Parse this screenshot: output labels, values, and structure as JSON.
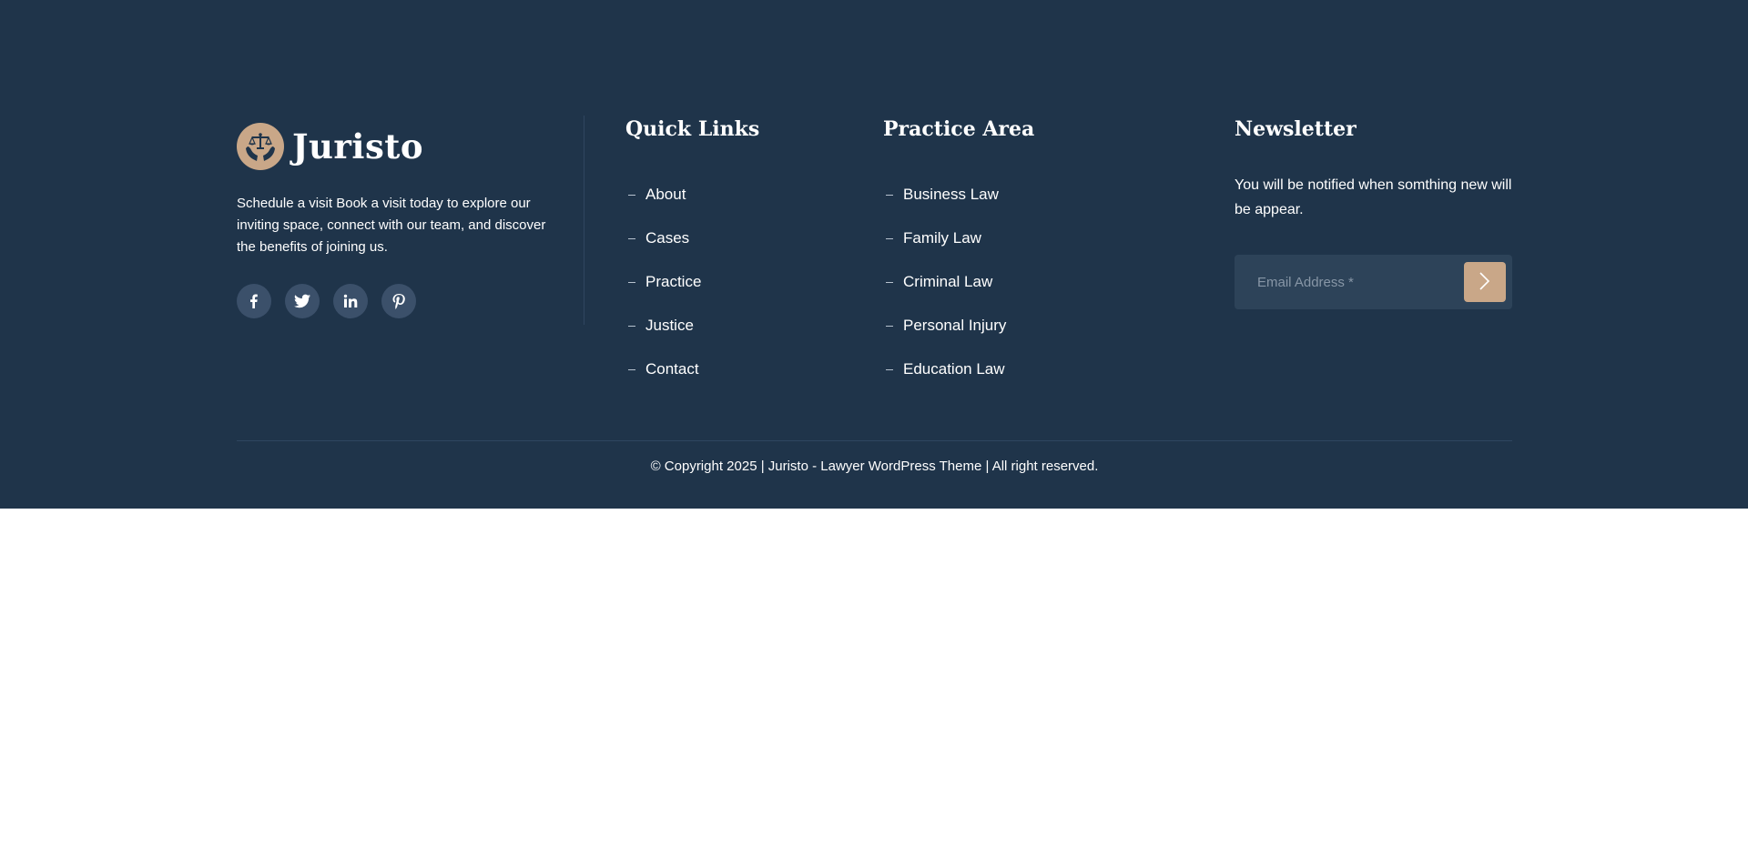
{
  "brand": {
    "name": "Juristo",
    "description": "Schedule a visit Book a visit today to explore our inviting space, connect with our team, and discover the benefits of joining us.",
    "logo_icon": "scales-of-justice-in-hands-icon",
    "accent_color": "#c9a788",
    "socials": [
      {
        "icon": "facebook-icon"
      },
      {
        "icon": "twitter-icon"
      },
      {
        "icon": "linkedin-icon"
      },
      {
        "icon": "pinterest-icon"
      }
    ]
  },
  "quick_links": {
    "title": "Quick Links",
    "items": [
      "About",
      "Cases",
      "Practice",
      "Justice",
      "Contact"
    ]
  },
  "practice_area": {
    "title": "Practice Area",
    "items": [
      "Business Law",
      "Family Law",
      "Criminal Law",
      "Personal Injury",
      "Education Law"
    ]
  },
  "newsletter": {
    "title": "Newsletter",
    "description": "You will be notified when somthing new will be appear.",
    "email_placeholder": "Email Address *",
    "submit_icon": "chevron-right-icon"
  },
  "footer": {
    "copyright": "© Copyright 2025 | Juristo - Lawyer WordPress Theme | All right reserved.",
    "background_color": "#1f344a"
  }
}
